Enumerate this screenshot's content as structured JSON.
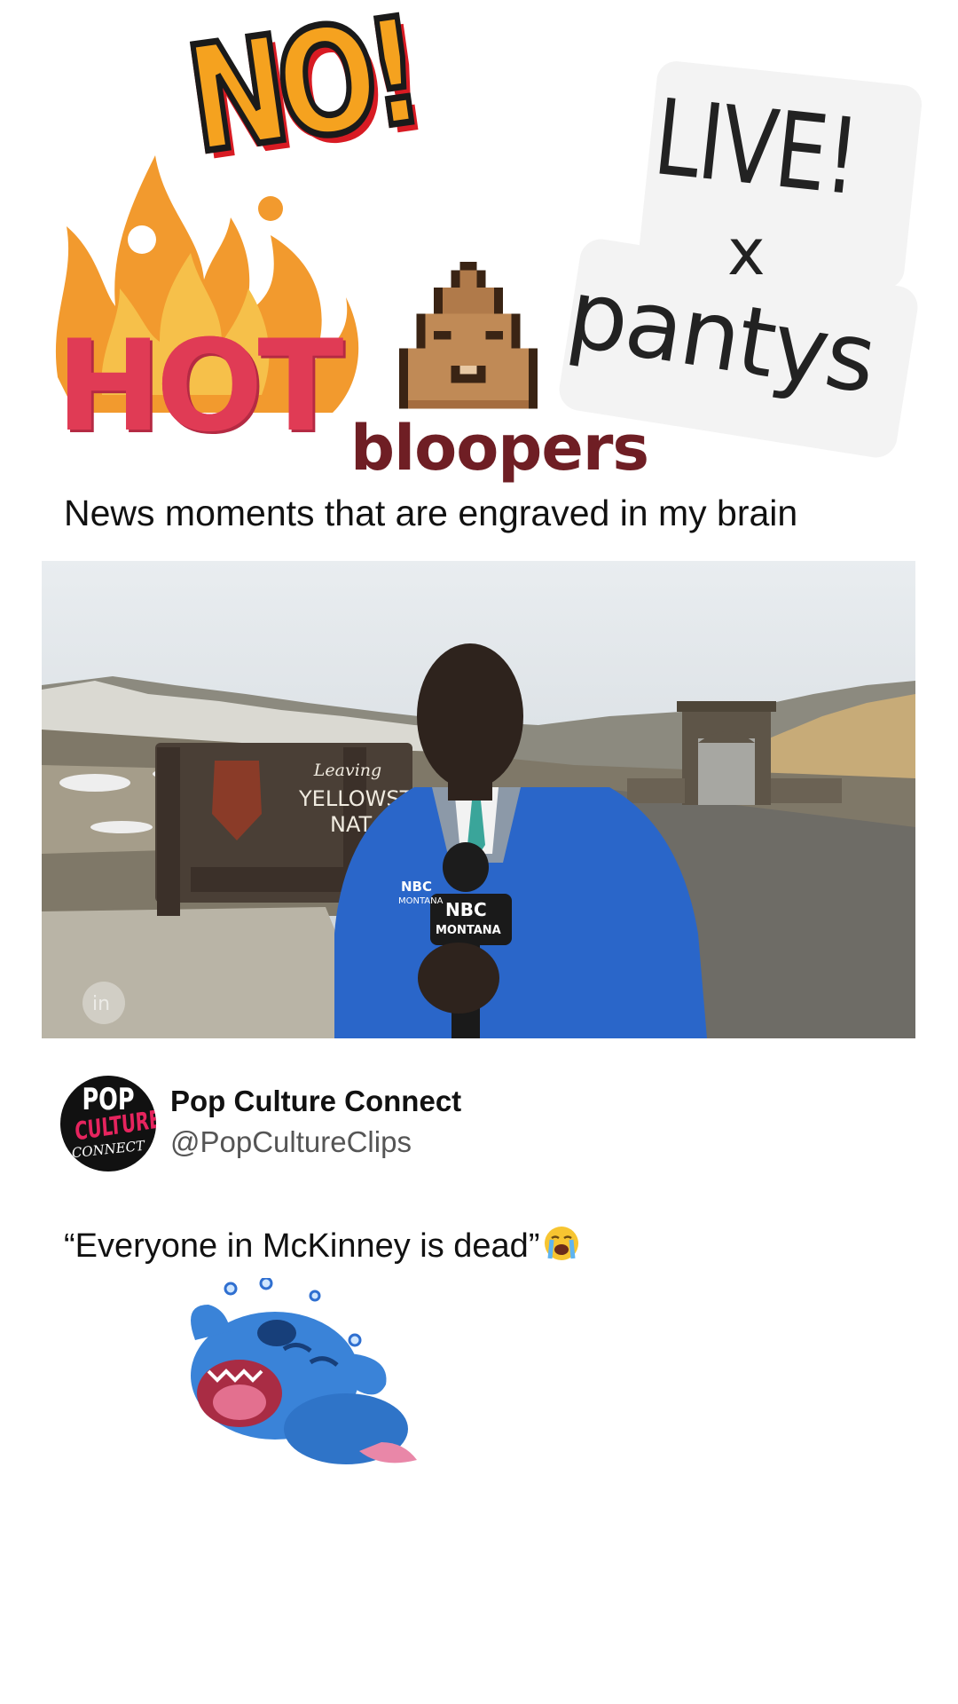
{
  "stickers": {
    "no": "NO!",
    "hot": "HOT",
    "bloopers": "bloopers",
    "live": "LIVE!",
    "x": "x",
    "pantys": "pantys"
  },
  "caption": "News moments that are engraved in my brain",
  "video": {
    "sign_line1": "Leaving",
    "sign_line2": "YELLOWST",
    "sign_line3": "NAT",
    "mic_logo_line1": "NBC",
    "mic_logo_line2": "MONTANA",
    "jacket_logo_line1": "NBC",
    "jacket_logo_line2": "MONTANA",
    "watermark": "in"
  },
  "post": {
    "avatar_line1": "POP",
    "avatar_line2": "CULTURE",
    "avatar_line3": "CONNECT",
    "display_name": "Pop Culture Connect",
    "handle": "@PopCultureClips",
    "text": "“Everyone in McKinney is dead”"
  },
  "icons": {
    "emoji": "loudly-crying-face-icon",
    "sticker_poop": "poop-pixel-icon",
    "sticker_stitch": "stitch-laughing-icon"
  },
  "colors": {
    "no_fill": "#f5a21f",
    "no_shadow": "#d81b23",
    "hot": "#e03b55",
    "bloopers": "#6f1e24"
  }
}
